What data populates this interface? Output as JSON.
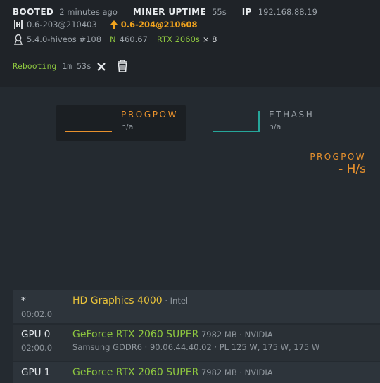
{
  "status": {
    "booted_label": "BOOTED",
    "booted_value": "2 minutes ago",
    "uptime_label": "MINER UPTIME",
    "uptime_value": "55s",
    "ip_label": "IP",
    "ip_value": "192.168.88.19"
  },
  "versions": {
    "hive_version": "0.6-203@210403",
    "update_version": "0.6-204@210608",
    "kernel": "5.4.0-hiveos #108",
    "nvidia_prefix": "N",
    "nvidia_driver": "460.67",
    "gpu_summary": "RTX 2060s",
    "gpu_count": "× 8"
  },
  "reboot": {
    "text": "Rebooting",
    "timer": "1m 53s"
  },
  "algos": [
    {
      "name": "PROGPOW",
      "value": "n/a",
      "color": "#e8912d"
    },
    {
      "name": "ETHASH",
      "value": "n/a",
      "color": "#26a69a"
    }
  ],
  "hashrate": {
    "algo": "PROGPOW",
    "value": "- H/s"
  },
  "gpus": [
    {
      "slot": "*",
      "bus": "00:02.0",
      "name": "HD Graphics 4000",
      "name_color": "#e8c23a",
      "meta": " · Intel",
      "sub": ""
    },
    {
      "slot": "GPU 0",
      "bus": "02:00.0",
      "name": "GeForce RTX 2060 SUPER",
      "name_color": "#8dc63f",
      "meta": " 7982 MB · NVIDIA",
      "sub": "Samsung GDDR6 · 90.06.44.40.02 · PL 125 W, 175 W, 175 W"
    },
    {
      "slot": "GPU 1",
      "bus": "",
      "name": "GeForce RTX 2060 SUPER",
      "name_color": "#8dc63f",
      "meta": " 7982 MB · NVIDIA",
      "sub": ""
    }
  ],
  "colors": {
    "accent_orange": "#e8912d",
    "accent_teal": "#26a69a",
    "nvidia_green": "#8dc63f",
    "warning": "#f0a31e"
  },
  "icons": [
    "hive-logo-icon",
    "arrow-up-icon",
    "linux-tux-icon",
    "close-icon",
    "trash-icon"
  ]
}
